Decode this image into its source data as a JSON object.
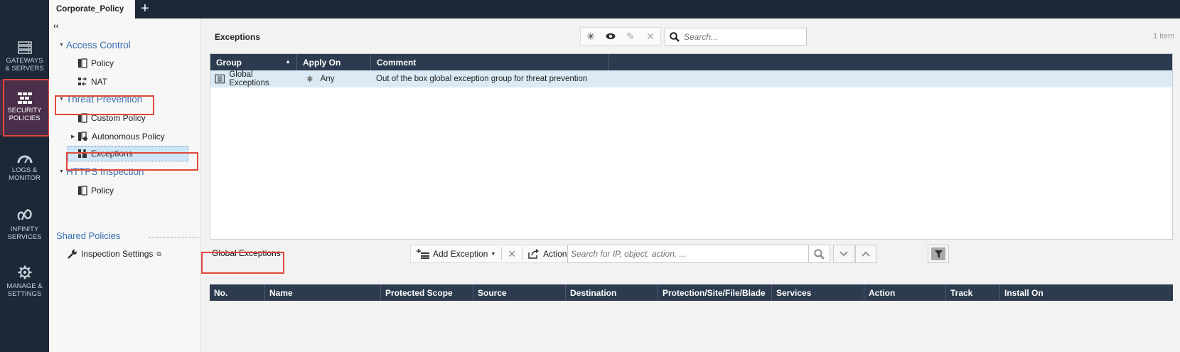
{
  "window": {
    "tab_label": "Corporate_Policy",
    "add_tab": "+"
  },
  "rail": {
    "items": [
      {
        "label": "GATEWAYS\n& SERVERS",
        "icon": "gateways-icon"
      },
      {
        "label": "SECURITY\nPOLICIES",
        "icon": "security-policies-icon",
        "active": true
      },
      {
        "label": "LOGS &\nMONITOR",
        "icon": "logs-monitor-icon"
      },
      {
        "label": "INFINITY\nSERVICES",
        "icon": "infinity-icon"
      },
      {
        "label": "MANAGE &\nSETTINGS",
        "icon": "gear-icon"
      }
    ]
  },
  "tree": {
    "collapse": "‹‹",
    "access_control": "Access Control",
    "access_policy": "Policy",
    "nat": "NAT",
    "threat_prevention": "Threat Prevention",
    "custom_policy": "Custom Policy",
    "autonomous_policy": "Autonomous Policy",
    "exceptions": "Exceptions",
    "https_inspection": "HTTPS Inspection",
    "https_policy": "Policy",
    "shared_policies": "Shared Policies",
    "inspection_settings": "Inspection Settings"
  },
  "exceptions_panel": {
    "title": "Exceptions",
    "search_placeholder": "Search...",
    "count": "1 item",
    "columns": [
      "Group",
      "Apply On",
      "Comment"
    ],
    "rows": [
      {
        "group": "Global Exceptions",
        "apply_on": "Any",
        "comment": "Out of the box global exception group for threat prevention"
      }
    ]
  },
  "global_exceptions": {
    "title": "Global Exceptions",
    "add_exception": "Add Exception",
    "actions": "Actions",
    "search_placeholder": "Search for IP, object, action, ...",
    "columns": [
      "No.",
      "Name",
      "Protected Scope",
      "Source",
      "Destination",
      "Protection/Site/File/Blade",
      "Services",
      "Action",
      "Track",
      "Install On"
    ]
  },
  "colors": {
    "rail_bg": "#1c2737",
    "rail_active": "#4a2f4a",
    "link_blue": "#3a6fb5",
    "grid_header": "#2c3b4f",
    "row_selected": "#dbeaf5",
    "highlight_red": "#e0483a"
  }
}
